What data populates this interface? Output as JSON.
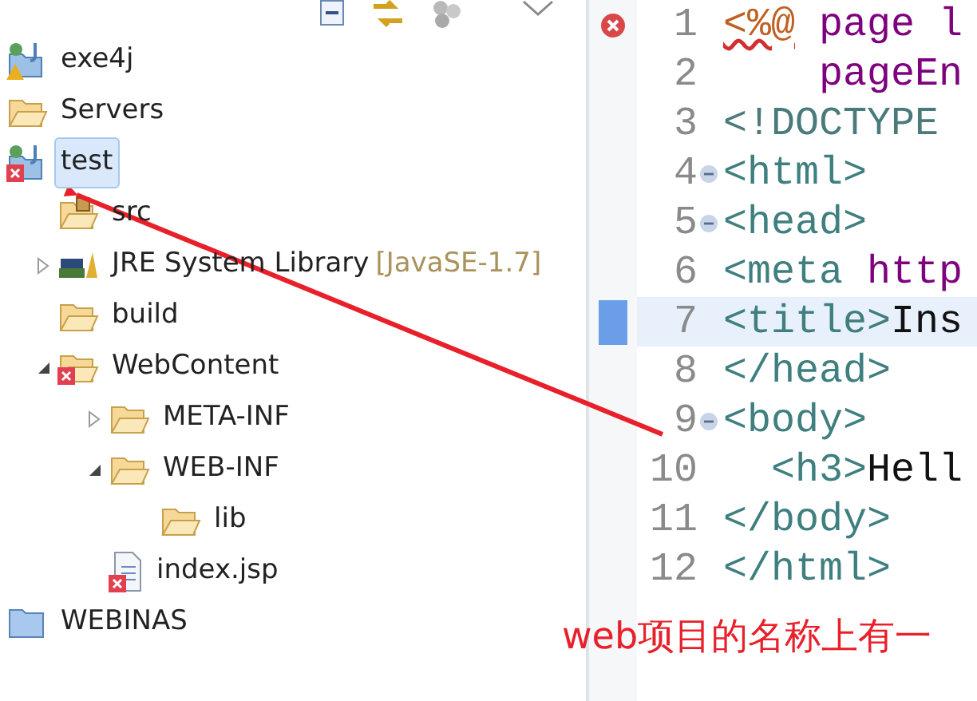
{
  "explorer": {
    "items": [
      {
        "label": "exe4j",
        "kind": "project",
        "has_error": false,
        "has_warning": true,
        "selected": false
      },
      {
        "label": "Servers",
        "kind": "folder",
        "has_error": false,
        "has_warning": false,
        "selected": false
      },
      {
        "label": "test",
        "kind": "project",
        "has_error": true,
        "has_warning": false,
        "selected": true,
        "children": [
          {
            "label": "src",
            "kind": "package-folder",
            "has_error": false,
            "has_warning": false,
            "selected": false
          },
          {
            "label": "JRE System Library",
            "decoration": "[JavaSE-1.7]",
            "kind": "library",
            "has_error": false,
            "has_warning": false,
            "expanded": false,
            "selected": false
          },
          {
            "label": "build",
            "kind": "folder",
            "has_error": false,
            "has_warning": false,
            "selected": false
          },
          {
            "label": "WebContent",
            "kind": "folder",
            "has_error": true,
            "has_warning": false,
            "expanded": true,
            "selected": false,
            "children": [
              {
                "label": "META-INF",
                "kind": "folder",
                "has_error": false,
                "has_warning": false,
                "expanded": false,
                "selected": false
              },
              {
                "label": "WEB-INF",
                "kind": "folder",
                "has_error": false,
                "has_warning": false,
                "expanded": true,
                "selected": false,
                "children": [
                  {
                    "label": "lib",
                    "kind": "folder",
                    "has_error": false,
                    "has_warning": false,
                    "selected": false
                  }
                ]
              },
              {
                "label": "index.jsp",
                "kind": "jsp",
                "has_error": true,
                "has_warning": false,
                "selected": false
              }
            ]
          }
        ]
      },
      {
        "label": "WEBINAS",
        "kind": "closed-project",
        "has_error": false,
        "has_warning": false,
        "selected": false
      }
    ]
  },
  "editor": {
    "lines": [
      {
        "number": "1",
        "error": true,
        "fold": false,
        "current": false,
        "segments": [
          {
            "t": "<%@",
            "kind": "directive"
          },
          {
            "t": " page l",
            "kind": "attr"
          }
        ]
      },
      {
        "number": "2",
        "error": false,
        "fold": false,
        "current": false,
        "segments": [
          {
            "t": "    pageEn",
            "kind": "attr"
          }
        ]
      },
      {
        "number": "3",
        "error": false,
        "fold": false,
        "current": false,
        "segments": [
          {
            "t": "<!DOCTYPE",
            "kind": "doctype"
          }
        ]
      },
      {
        "number": "4",
        "error": false,
        "fold": true,
        "current": false,
        "segments": [
          {
            "t": "<html>",
            "kind": "tag"
          }
        ]
      },
      {
        "number": "5",
        "error": false,
        "fold": true,
        "current": false,
        "segments": [
          {
            "t": "<head>",
            "kind": "tag"
          }
        ]
      },
      {
        "number": "6",
        "error": false,
        "fold": false,
        "current": false,
        "segments": [
          {
            "t": "<meta",
            "kind": "tag"
          },
          {
            "t": " http",
            "kind": "attr"
          }
        ]
      },
      {
        "number": "7",
        "error": false,
        "fold": false,
        "current": true,
        "segments": [
          {
            "t": "<title>",
            "kind": "tag"
          },
          {
            "t": "Ins",
            "kind": "text"
          }
        ]
      },
      {
        "number": "8",
        "error": false,
        "fold": false,
        "current": false,
        "segments": [
          {
            "t": "</head>",
            "kind": "tag"
          }
        ]
      },
      {
        "number": "9",
        "error": false,
        "fold": true,
        "current": false,
        "segments": [
          {
            "t": "<body>",
            "kind": "tag"
          }
        ]
      },
      {
        "number": "10",
        "error": false,
        "fold": false,
        "current": false,
        "segments": [
          {
            "t": "  <h3>",
            "kind": "tag"
          },
          {
            "t": "Hell",
            "kind": "text"
          }
        ]
      },
      {
        "number": "11",
        "error": false,
        "fold": false,
        "current": false,
        "segments": [
          {
            "t": "</body>",
            "kind": "tag"
          }
        ]
      },
      {
        "number": "12",
        "error": false,
        "fold": false,
        "current": false,
        "segments": [
          {
            "t": "</html>",
            "kind": "tag"
          }
        ]
      }
    ]
  },
  "annotation": {
    "text": "web项目的名称上有一"
  }
}
